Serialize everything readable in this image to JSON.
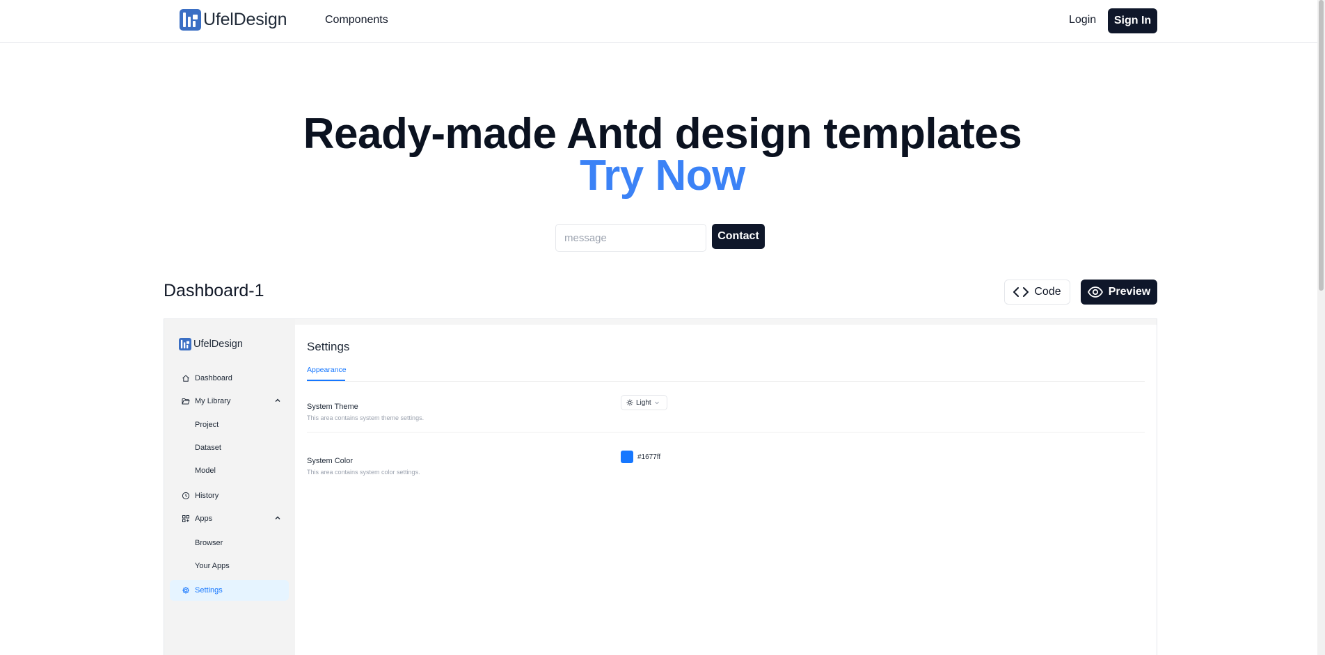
{
  "nav": {
    "brand": "UfelDesign",
    "components": "Components",
    "login": "Login",
    "signin": "Sign In"
  },
  "hero": {
    "title": "Ready-made Antd design templates",
    "subtitle": "Try Now",
    "input_placeholder": "message",
    "contact_label": "Contact"
  },
  "section": {
    "title": "Dashboard-1",
    "code_label": "Code",
    "preview_label": "Preview"
  },
  "preview": {
    "brand": "UfelDesign",
    "sidebar": [
      {
        "label": "Dashboard",
        "icon": "home-icon"
      },
      {
        "label": "My Library",
        "icon": "folder-open-icon"
      },
      {
        "label": "Project"
      },
      {
        "label": "Dataset"
      },
      {
        "label": "Model"
      },
      {
        "label": "History",
        "icon": "clock-icon"
      },
      {
        "label": "Apps",
        "icon": "apps-icon"
      },
      {
        "label": "Browser"
      },
      {
        "label": "Your Apps"
      },
      {
        "label": "Settings",
        "icon": "gear-icon"
      }
    ],
    "content": {
      "title": "Settings",
      "tab": "Appearance",
      "theme_label": "System Theme",
      "theme_desc": "This area contains system theme settings.",
      "theme_value": "Light",
      "color_label": "System Color",
      "color_desc": "This area contains system color settings.",
      "color_value": "#1677ff"
    }
  },
  "colors": {
    "primary_dark": "#0f172a",
    "accent_blue": "#3b82f6",
    "antd_blue": "#1677ff"
  }
}
